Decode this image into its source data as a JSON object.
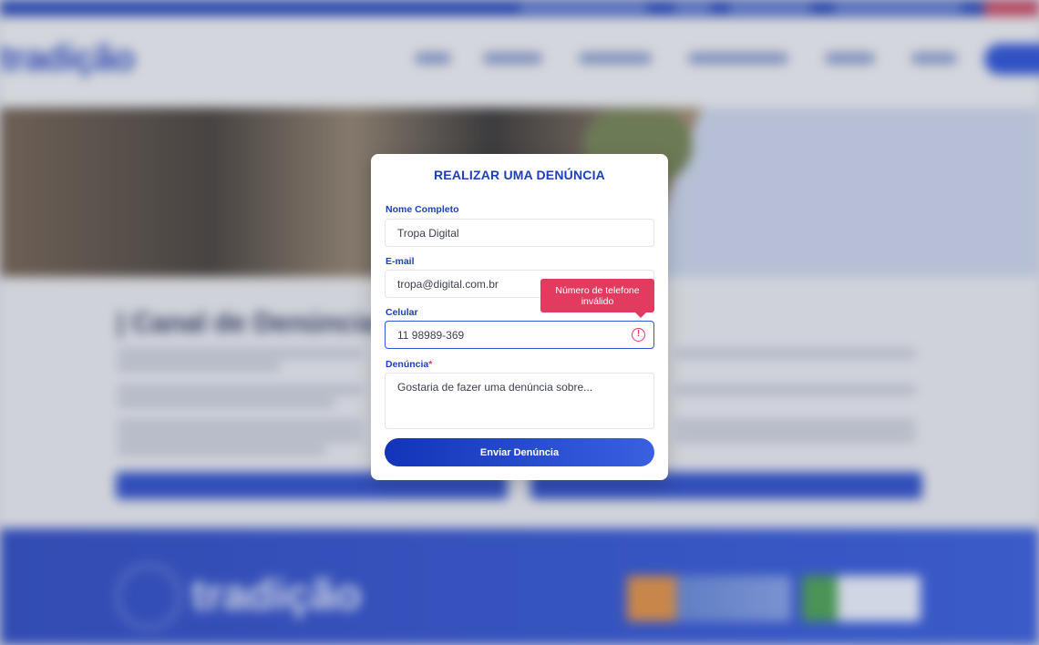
{
  "background": {
    "logo_text": "tradição",
    "section_title": "| Canal de Denúncia",
    "footer_logo_text": "tradição"
  },
  "modal": {
    "title": "REALIZAR UMA DENÚNCIA",
    "fields": {
      "name": {
        "label": "Nome Completo",
        "value": "Tropa Digital"
      },
      "email": {
        "label": "E-mail",
        "value": "tropa@digital.com.br"
      },
      "phone": {
        "label": "Celular",
        "value": "11 98989-369",
        "error_icon": "exclamation-circle-icon",
        "error_tooltip_line1": "Número de telefone",
        "error_tooltip_line2": "inválido"
      },
      "complaint": {
        "label": "Denúncia",
        "required_mark": "*",
        "value": "Gostaria de fazer uma denúncia sobre..."
      }
    },
    "submit_label": "Enviar Denúncia"
  },
  "colors": {
    "accent": "#1d3fb8",
    "error": "#e23b5f",
    "button_gradient_start": "#1234b8",
    "button_gradient_end": "#3a60e0"
  }
}
